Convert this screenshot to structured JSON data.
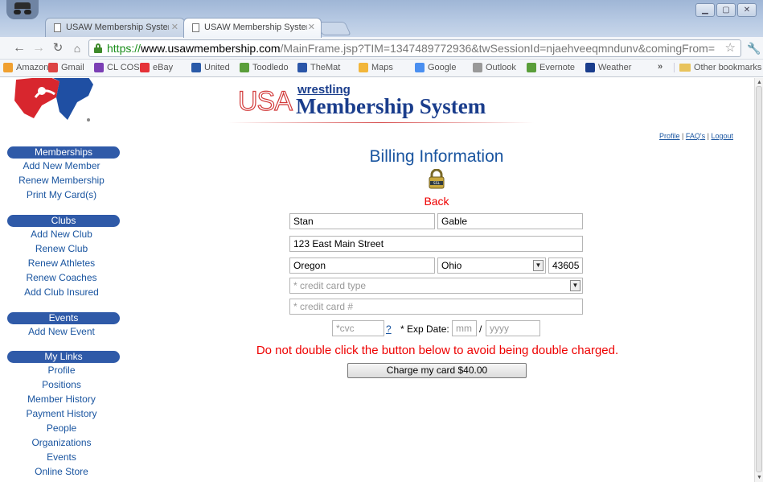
{
  "browser": {
    "tabs": [
      {
        "title": "USAW Membership Systen",
        "active": false
      },
      {
        "title": "USAW Membership Systen",
        "active": true
      }
    ],
    "url_protocol": "https://",
    "url_host": "www.usawmembership.com",
    "url_path": "/MainFrame.jsp?TIM=1347489772936&twSessionId=njaehveeqmndunv&comingFrom=",
    "bookmarks": [
      {
        "label": "Amazon",
        "color": "#f0a030"
      },
      {
        "label": "Gmail",
        "color": "#d44"
      },
      {
        "label": "CL COS",
        "color": "#7b3fb4"
      },
      {
        "label": "eBay",
        "color": "#e53238"
      },
      {
        "label": "United",
        "color": "#2a5aa8"
      },
      {
        "label": "Toodledo",
        "color": "#5a9e3a"
      },
      {
        "label": "TheMat",
        "color": "#2b56a8"
      },
      {
        "label": "Maps",
        "color": "#f2b63a"
      },
      {
        "label": "Google",
        "color": "#4a8ff0"
      },
      {
        "label": "Outlook",
        "color": "#999"
      },
      {
        "label": "Evernote",
        "color": "#5a9e3a"
      },
      {
        "label": "Weather",
        "color": "#1a3d8c"
      }
    ],
    "bookmarks_more": "»",
    "other_bookmarks": "Other bookmarks"
  },
  "banner": {
    "usa": "USA",
    "wrestling": "wrestling",
    "title": "Membership System"
  },
  "top_links": {
    "profile": "Profile",
    "faqs": "FAQ's",
    "logout": "Logout",
    "sep": "|"
  },
  "nav": {
    "memberships": {
      "header": "Memberships",
      "items": [
        "Add New Member",
        "Renew Membership",
        "Print My Card(s)"
      ]
    },
    "clubs": {
      "header": "Clubs",
      "items": [
        "Add New Club",
        "Renew Club",
        "Renew Athletes",
        "Renew Coaches",
        "Add Club Insured"
      ]
    },
    "events": {
      "header": "Events",
      "items": [
        "Add New Event"
      ]
    },
    "my_links": {
      "header": "My Links",
      "items": [
        "Profile",
        "Positions",
        "Member History",
        "Payment History",
        "People",
        "Organizations",
        "Events",
        "Online Store"
      ]
    }
  },
  "billing": {
    "title": "Billing Information",
    "back": "Back",
    "first_name": "Stan",
    "last_name": "Gable",
    "address": "123 East Main Street",
    "city": "Oregon",
    "state": "Ohio",
    "zip": "43605",
    "card_type_placeholder": "* credit card type",
    "card_number_placeholder": "* credit card #",
    "cvc_placeholder": "*cvc",
    "cvc_help": "?",
    "exp_label": "* Exp Date:",
    "exp_month_placeholder": "mm",
    "exp_slash": "/",
    "exp_year_placeholder": "yyyy",
    "warning": "Do not double click the button below to avoid being double charged.",
    "charge_button": "Charge my card $40.00"
  },
  "colors": {
    "nav_header": "#2f5aa8",
    "link": "#1a55a0",
    "warning": "#e00000",
    "brand_red": "#d23a3a",
    "brand_blue": "#1a3d8c"
  }
}
